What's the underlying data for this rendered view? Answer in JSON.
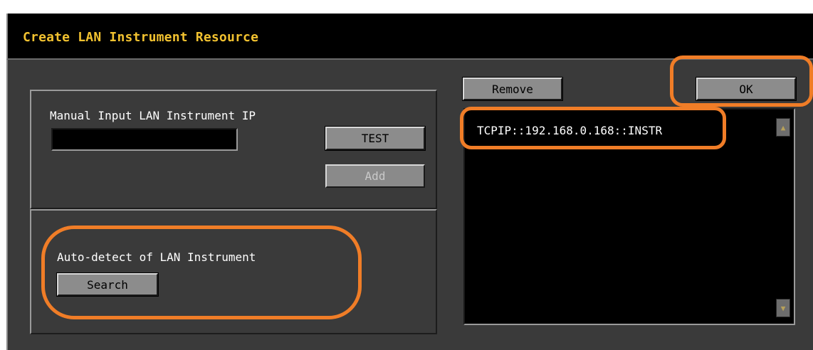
{
  "dialog": {
    "title": "Create LAN Instrument Resource"
  },
  "manual": {
    "label": "Manual Input LAN Instrument IP",
    "ip_value": "",
    "test_label": "TEST",
    "add_label": "Add"
  },
  "auto": {
    "label": "Auto-detect of LAN Instrument",
    "search_label": "Search"
  },
  "resources": {
    "remove_label": "Remove",
    "ok_label": "OK",
    "items": [
      "TCPIP::192.168.0.168::INSTR"
    ]
  },
  "icons": {
    "scroll_up": "triangle-up-icon",
    "scroll_down": "triangle-down-icon"
  },
  "colors": {
    "title": "#f2c230",
    "highlight": "#f07d27",
    "window_bg": "#3a3a3a"
  }
}
